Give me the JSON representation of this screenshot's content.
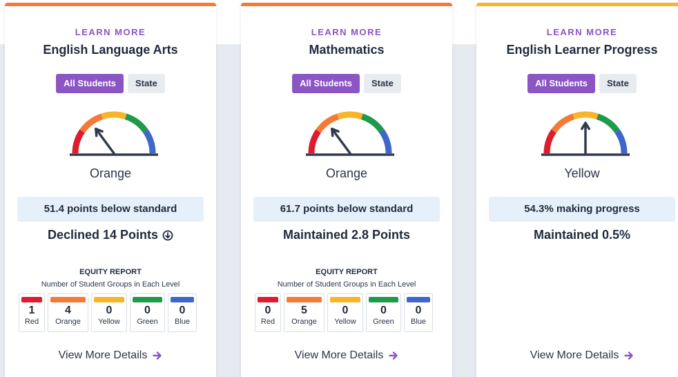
{
  "colors": {
    "red": "#dd1c2d",
    "orange": "#f47a36",
    "yellow": "#f7b52c",
    "green": "#1f9a4b",
    "blue": "#3f67c9",
    "purple": "#8b55c4",
    "pill": "#e5f0fb"
  },
  "cards": [
    {
      "learn_more": "LEARN MORE",
      "title": "English Language Arts",
      "toggle": {
        "all": "All Students",
        "state": "State"
      },
      "gauge_level": "orange",
      "level_label": "Orange",
      "status": "51.4 points below standard",
      "change": "Declined 14 Points",
      "change_icon": "arrow-down-circle-icon",
      "equity": {
        "title": "EQUITY REPORT",
        "subtitle": "Number of Student Groups in Each Level",
        "levels": [
          {
            "label": "Red",
            "count": "1"
          },
          {
            "label": "Orange",
            "count": "4"
          },
          {
            "label": "Yellow",
            "count": "0"
          },
          {
            "label": "Green",
            "count": "0"
          },
          {
            "label": "Blue",
            "count": "0"
          }
        ]
      },
      "details": "View More Details"
    },
    {
      "learn_more": "LEARN MORE",
      "title": "Mathematics",
      "toggle": {
        "all": "All Students",
        "state": "State"
      },
      "gauge_level": "orange",
      "level_label": "Orange",
      "status": "61.7 points below standard",
      "change": "Maintained 2.8 Points",
      "equity": {
        "title": "EQUITY REPORT",
        "subtitle": "Number of Student Groups in Each Level",
        "levels": [
          {
            "label": "Red",
            "count": "0"
          },
          {
            "label": "Orange",
            "count": "5"
          },
          {
            "label": "Yellow",
            "count": "0"
          },
          {
            "label": "Green",
            "count": "0"
          },
          {
            "label": "Blue",
            "count": "0"
          }
        ]
      },
      "details": "View More Details"
    },
    {
      "learn_more": "LEARN MORE",
      "title": "English Learner Progress",
      "toggle": {
        "all": "All Students",
        "state": "State"
      },
      "gauge_level": "yellow",
      "level_label": "Yellow",
      "status": "54.3% making progress",
      "change": "Maintained 0.5%",
      "details": "View More Details"
    }
  ]
}
